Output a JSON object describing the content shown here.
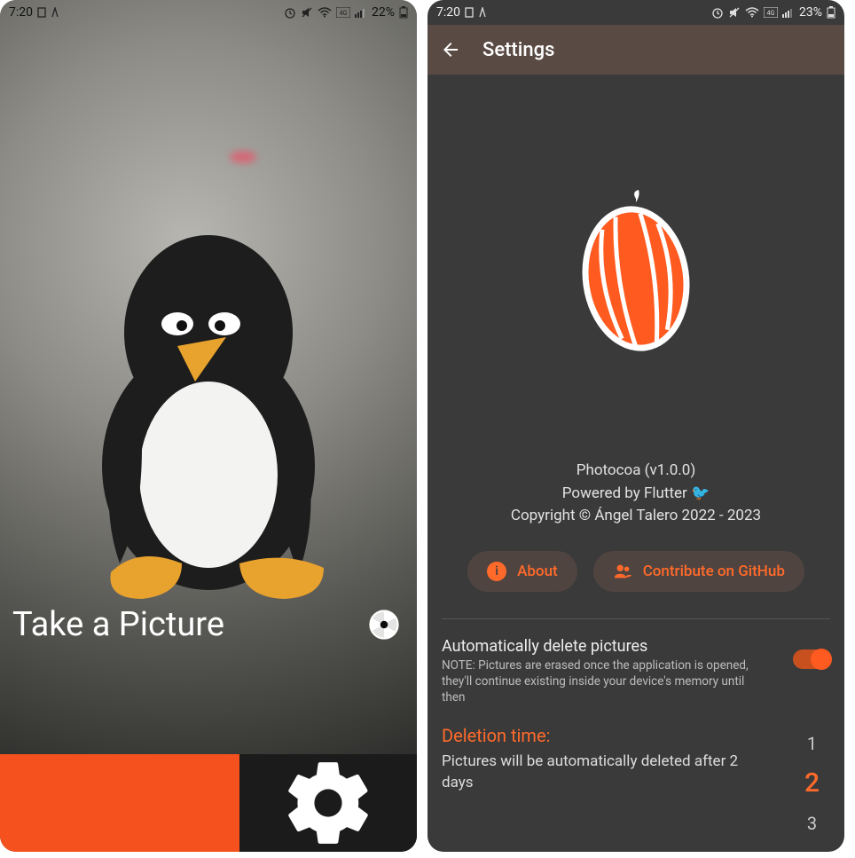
{
  "screen1": {
    "status": {
      "time": "7:20",
      "battery": "22%"
    },
    "label": "Take a Picture"
  },
  "screen2": {
    "status": {
      "time": "7:20",
      "battery": "23%"
    },
    "appbar_title": "Settings",
    "info": {
      "line1": "Photocoa (v1.0.0)",
      "line2": "Powered by Flutter 🐦",
      "line3": "Copyright © Ángel Talero 2022 - 2023"
    },
    "chips": {
      "about": "About",
      "contribute": "Contribute on GitHub"
    },
    "auto_delete": {
      "title": "Automatically delete pictures",
      "note": "NOTE: Pictures are erased once the application is opened, they'll continue existing inside your device's memory until then",
      "enabled": true
    },
    "deletion": {
      "heading": "Deletion time:",
      "sub": "Pictures will be automatically deleted after 2 days",
      "options": [
        "1",
        "2",
        "3"
      ],
      "selected": "2"
    }
  }
}
